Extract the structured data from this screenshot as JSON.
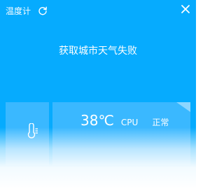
{
  "window": {
    "title": "温度计"
  },
  "icons": {
    "refresh": "refresh-icon",
    "close": "close-icon",
    "thermometer": "thermometer-icon"
  },
  "status": {
    "message": "获取城市天气失败"
  },
  "sensor": {
    "temperature": "38℃",
    "label": "CPU",
    "state": "正常"
  },
  "colors": {
    "background": "#06abfe",
    "card": "#3ab8ff",
    "text": "#ffffff"
  }
}
